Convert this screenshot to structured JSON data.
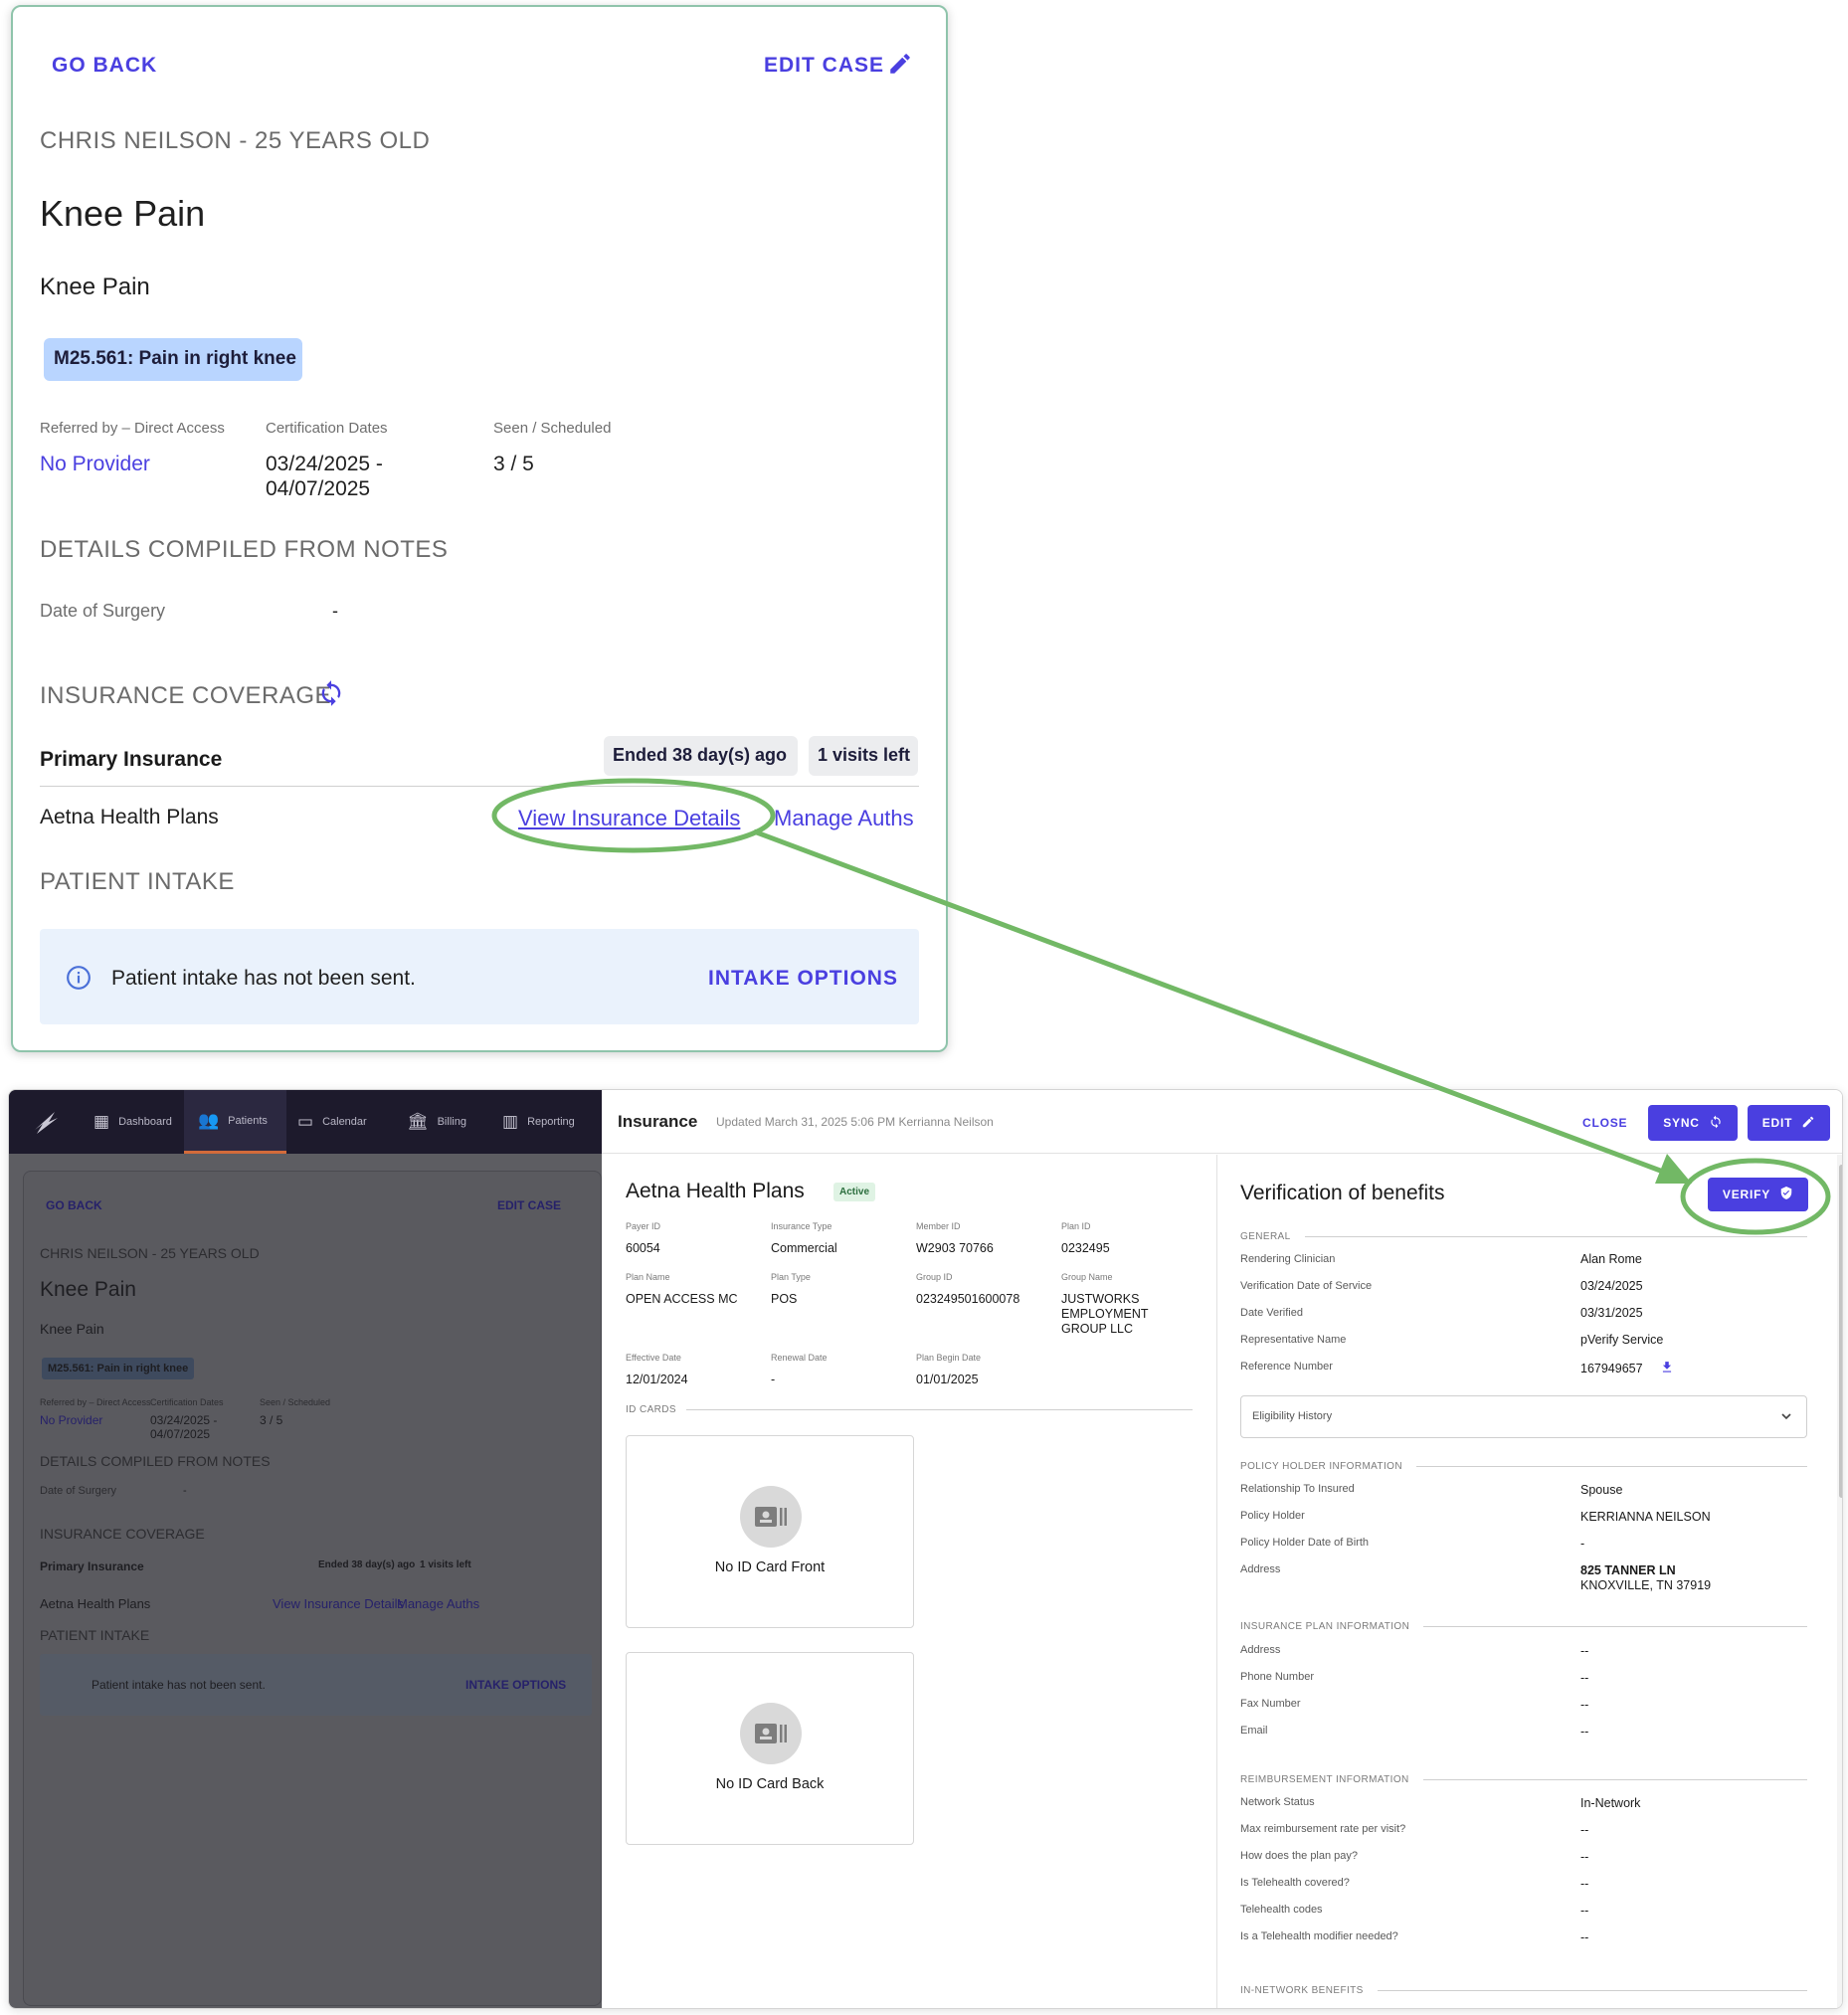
{
  "top_card": {
    "go_back": "GO BACK",
    "edit_case": "EDIT CASE",
    "patient_header": "CHRIS NEILSON - 25 YEARS OLD",
    "case_title": "Knee Pain",
    "case_subtitle": "Knee Pain",
    "diagnosis_chip": "M25.561: Pain in right knee",
    "referred_label": "Referred by – Direct Access",
    "referred_value": "No Provider",
    "cert_label": "Certification Dates",
    "cert_value_line1": "03/24/2025 -",
    "cert_value_line2": "04/07/2025",
    "seen_label": "Seen / Scheduled",
    "seen_value": "3 / 5",
    "details_heading": "DETAILS COMPILED FROM NOTES",
    "surgery_label": "Date of Surgery",
    "surgery_value": "-",
    "coverage_heading": "INSURANCE COVERAGE",
    "primary_insurance": "Primary Insurance",
    "ended_chip": "Ended 38 day(s) ago",
    "visits_chip": "1 visits left",
    "insurer_name": "Aetna Health Plans",
    "view_details_link": "View Insurance Details",
    "manage_auths_link": "Manage Auths",
    "intake_heading": "PATIENT INTAKE",
    "intake_message": "Patient intake has not been sent.",
    "intake_options": "INTAKE OPTIONS"
  },
  "nav": {
    "items": [
      {
        "label": "Dashboard",
        "icon": "dashboard-icon"
      },
      {
        "label": "Patients",
        "icon": "patients-icon"
      },
      {
        "label": "Calendar",
        "icon": "calendar-icon"
      },
      {
        "label": "Billing",
        "icon": "billing-icon"
      },
      {
        "label": "Reporting",
        "icon": "reporting-icon"
      }
    ],
    "active": "Patients"
  },
  "insurance_drawer": {
    "title": "Insurance",
    "updated": "Updated March 31, 2025 5:06 PM Kerrianna Neilson",
    "close_label": "CLOSE",
    "sync_label": "SYNC",
    "edit_label": "EDIT",
    "plan_name": "Aetna Health Plans",
    "status_badge": "Active",
    "fields_row1": [
      {
        "label": "Payer ID",
        "value": "60054"
      },
      {
        "label": "Insurance Type",
        "value": "Commercial"
      },
      {
        "label": "Member ID",
        "value": "W2903 70766"
      },
      {
        "label": "Plan ID",
        "value": "0232495"
      }
    ],
    "fields_row2": [
      {
        "label": "Plan Name",
        "value": "OPEN ACCESS MC"
      },
      {
        "label": "Plan Type",
        "value": "POS"
      },
      {
        "label": "Group ID",
        "value": "023249501600078"
      },
      {
        "label": "Group Name",
        "value_lines": [
          "JUSTWORKS",
          "EMPLOYMENT",
          "GROUP LLC"
        ]
      }
    ],
    "fields_row3": [
      {
        "label": "Effective Date",
        "value": "12/01/2024"
      },
      {
        "label": "Renewal Date",
        "value": "-"
      },
      {
        "label": "Plan Begin Date",
        "value": "01/01/2025"
      }
    ],
    "id_cards_label": "ID CARDS",
    "id_front": "No ID Card Front",
    "id_back": "No ID Card Back"
  },
  "vob": {
    "title": "Verification of benefits",
    "verify_label": "VERIFY",
    "general_label": "GENERAL",
    "general": [
      {
        "label": "Rendering Clinician",
        "value": "Alan Rome"
      },
      {
        "label": "Verification Date of Service",
        "value": "03/24/2025"
      },
      {
        "label": "Date Verified",
        "value": "03/31/2025"
      },
      {
        "label": "Representative Name",
        "value": "pVerify Service"
      },
      {
        "label": "Reference Number",
        "value": "167949657"
      }
    ],
    "eligibility_history": "Eligibility History",
    "policy_label": "POLICY HOLDER INFORMATION",
    "policy": [
      {
        "label": "Relationship To Insured",
        "value": "Spouse"
      },
      {
        "label": "Policy Holder",
        "value": "KERRIANNA NEILSON"
      },
      {
        "label": "Policy Holder Date of Birth",
        "value": "-"
      },
      {
        "label": "Address",
        "value_lines": [
          "825 TANNER LN",
          "KNOXVILLE, TN 37919"
        ]
      }
    ],
    "plan_info_label": "INSURANCE PLAN INFORMATION",
    "plan_info": [
      {
        "label": "Address",
        "value": "--"
      },
      {
        "label": "Phone Number",
        "value": "--"
      },
      {
        "label": "Fax Number",
        "value": "--"
      },
      {
        "label": "Email",
        "value": "--"
      }
    ],
    "reimb_label": "REIMBURSEMENT INFORMATION",
    "reimb": [
      {
        "label": "Network Status",
        "value": "In-Network"
      },
      {
        "label": "Max reimbursement rate per visit?",
        "value": "--"
      },
      {
        "label": "How does the plan pay?",
        "value": "--"
      },
      {
        "label": "Is Telehealth covered?",
        "value": "--"
      },
      {
        "label": "Telehealth codes",
        "value": "--"
      },
      {
        "label": "Is a Telehealth modifier needed?",
        "value": "--"
      }
    ],
    "in_network_label": "IN-NETWORK BENEFITS"
  },
  "colors": {
    "accent": "#4a3fe0",
    "highlight_green": "#72b865",
    "nav_bg": "#1d1a2c",
    "chip_blue": "#b9d5ff",
    "intake_bg": "#eaf2fc"
  }
}
